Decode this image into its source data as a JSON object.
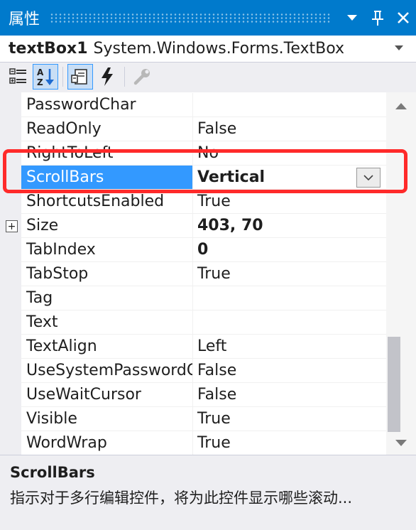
{
  "window": {
    "title": "属性",
    "buttons": [
      "dropdown",
      "pin",
      "close"
    ]
  },
  "object_selector": {
    "name": "textBox1",
    "type": "System.Windows.Forms.TextBox"
  },
  "toolbar": {
    "tools": [
      {
        "name": "categorized",
        "icon": "categorized-icon",
        "checked": false
      },
      {
        "name": "alphabetical",
        "icon": "alphabetical-sort-icon",
        "checked": true
      },
      {
        "name": "properties",
        "icon": "properties-icon",
        "checked": true
      },
      {
        "name": "events",
        "icon": "lightning-icon",
        "checked": false
      },
      {
        "name": "property-pages",
        "icon": "wrench-icon",
        "checked": false
      }
    ]
  },
  "properties": [
    {
      "name": "PasswordChar",
      "value": "",
      "bold": false
    },
    {
      "name": "ReadOnly",
      "value": "False",
      "bold": false
    },
    {
      "name": "RightToLeft",
      "value": "No",
      "bold": false
    },
    {
      "name": "ScrollBars",
      "value": "Vertical",
      "bold": true,
      "selected": true
    },
    {
      "name": "ShortcutsEnabled",
      "value": "True",
      "bold": false
    },
    {
      "name": "Size",
      "value": "403, 70",
      "bold": true,
      "expandable": true,
      "expander": "+"
    },
    {
      "name": "TabIndex",
      "value": "0",
      "bold": true
    },
    {
      "name": "TabStop",
      "value": "True",
      "bold": false
    },
    {
      "name": "Tag",
      "value": "",
      "bold": false
    },
    {
      "name": "Text",
      "value": "",
      "bold": false
    },
    {
      "name": "TextAlign",
      "value": "Left",
      "bold": false
    },
    {
      "name": "UseSystemPasswordChar",
      "value": "False",
      "bold": false
    },
    {
      "name": "UseWaitCursor",
      "value": "False",
      "bold": false
    },
    {
      "name": "Visible",
      "value": "True",
      "bold": false
    },
    {
      "name": "WordWrap",
      "value": "True",
      "bold": false
    }
  ],
  "description": {
    "title": "ScrollBars",
    "text": "指示对于多行编辑控件，将为此控件显示哪些滚动..."
  },
  "colors": {
    "title_bar": "#007acc",
    "selection": "#3399ff",
    "annotation": "#ff2a2a"
  }
}
